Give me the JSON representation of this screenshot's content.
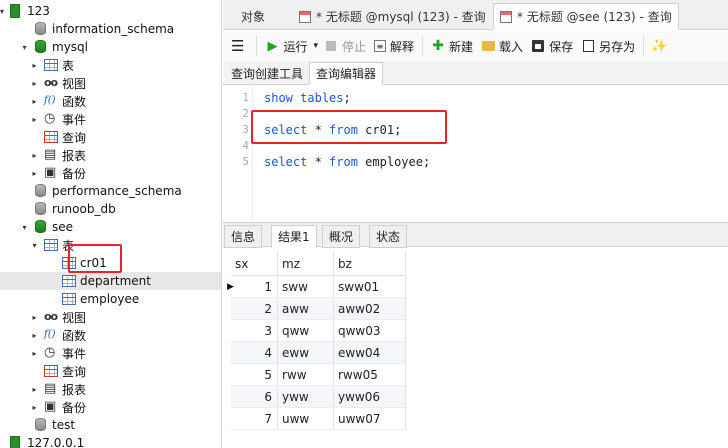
{
  "tree": {
    "items": [
      {
        "label": "123",
        "icon": "server-icon",
        "arrow": "▾",
        "indent": 0
      },
      {
        "label": "information_schema",
        "icon": "database-gray-icon",
        "arrow": "",
        "indent": 1
      },
      {
        "label": "mysql",
        "icon": "database-green-icon",
        "arrow": "▾",
        "indent": 1
      },
      {
        "label": "表",
        "icon": "table-icon",
        "arrow": "▸",
        "indent": 2
      },
      {
        "label": "视图",
        "icon": "view-icon",
        "arrow": "▸",
        "indent": 2
      },
      {
        "label": "函数",
        "icon": "function-icon",
        "arrow": "▸",
        "indent": 2
      },
      {
        "label": "事件",
        "icon": "event-icon",
        "arrow": "▸",
        "indent": 2
      },
      {
        "label": "查询",
        "icon": "query-icon",
        "arrow": "",
        "indent": 2
      },
      {
        "label": "报表",
        "icon": "report-icon",
        "arrow": "▸",
        "indent": 2
      },
      {
        "label": "备份",
        "icon": "backup-icon",
        "arrow": "▸",
        "indent": 2
      },
      {
        "label": "performance_schema",
        "icon": "database-gray-icon",
        "arrow": "",
        "indent": 1
      },
      {
        "label": "runoob_db",
        "icon": "database-gray-icon",
        "arrow": "",
        "indent": 1
      },
      {
        "label": "see",
        "icon": "database-green-icon",
        "arrow": "▾",
        "indent": 1
      },
      {
        "label": "表",
        "icon": "table-icon",
        "arrow": "▾",
        "indent": 2
      },
      {
        "label": "cr01",
        "icon": "table-icon",
        "arrow": "",
        "indent": 3
      },
      {
        "label": "department",
        "icon": "table-icon",
        "arrow": "",
        "indent": 3,
        "selected": true
      },
      {
        "label": "employee",
        "icon": "table-icon",
        "arrow": "",
        "indent": 3
      },
      {
        "label": "视图",
        "icon": "view-icon",
        "arrow": "▸",
        "indent": 2
      },
      {
        "label": "函数",
        "icon": "function-icon",
        "arrow": "▸",
        "indent": 2
      },
      {
        "label": "事件",
        "icon": "event-icon",
        "arrow": "▸",
        "indent": 2
      },
      {
        "label": "查询",
        "icon": "query-icon",
        "arrow": "",
        "indent": 2
      },
      {
        "label": "报表",
        "icon": "report-icon",
        "arrow": "▸",
        "indent": 2
      },
      {
        "label": "备份",
        "icon": "backup-icon",
        "arrow": "▸",
        "indent": 2
      },
      {
        "label": "test",
        "icon": "database-gray-icon",
        "arrow": "",
        "indent": 1
      },
      {
        "label": "127.0.0.1",
        "icon": "server-icon",
        "arrow": "",
        "indent": 0
      }
    ]
  },
  "tabs": [
    {
      "label": "对象",
      "active": false
    },
    {
      "label": "* 无标题 @mysql (123) - 查询",
      "active": false
    },
    {
      "label": "* 无标题 @see (123) - 查询",
      "active": true
    }
  ],
  "toolbar": {
    "menu_icon": "hamburger-icon",
    "run_label": "运行",
    "run_dropdown": "▾",
    "stop_label": "停止",
    "explain_label": "解释",
    "new_label": "新建",
    "load_label": "载入",
    "save_label": "保存",
    "saveas_label": "另存为"
  },
  "subtabs": [
    {
      "label": "查询创建工具",
      "active": false
    },
    {
      "label": "查询编辑器",
      "active": true
    }
  ],
  "editor": {
    "lines": [
      {
        "n": "1",
        "tokens": [
          {
            "t": "show",
            "k": "kw"
          },
          {
            "t": " ",
            "k": "tx"
          },
          {
            "t": "tables",
            "k": "kw"
          },
          {
            "t": ";",
            "k": "tx"
          }
        ]
      },
      {
        "n": "2",
        "tokens": []
      },
      {
        "n": "3",
        "tokens": [
          {
            "t": "select",
            "k": "kw"
          },
          {
            "t": " * ",
            "k": "tx"
          },
          {
            "t": "from",
            "k": "kw"
          },
          {
            "t": " cr01;",
            "k": "tx"
          }
        ]
      },
      {
        "n": "4",
        "tokens": []
      },
      {
        "n": "5",
        "tokens": [
          {
            "t": "select",
            "k": "kw"
          },
          {
            "t": " * ",
            "k": "tx"
          },
          {
            "t": "from",
            "k": "kw"
          },
          {
            "t": " employee;",
            "k": "tx"
          }
        ]
      }
    ]
  },
  "result_tabs": [
    {
      "label": "信息",
      "active": false
    },
    {
      "label": "结果1",
      "active": true
    },
    {
      "label": "概况",
      "active": false
    },
    {
      "label": "状态",
      "active": false
    }
  ],
  "grid": {
    "columns": [
      "sx",
      "mz",
      "bz"
    ],
    "current_row_marker": "▶",
    "rows": [
      [
        "1",
        "sww",
        "sww01"
      ],
      [
        "2",
        "aww",
        "aww02"
      ],
      [
        "3",
        "qww",
        "qww03"
      ],
      [
        "4",
        "eww",
        "eww04"
      ],
      [
        "5",
        "rww",
        "rww05"
      ],
      [
        "6",
        "yww",
        "yww06"
      ],
      [
        "7",
        "uww",
        "uww07"
      ]
    ]
  },
  "colors": {
    "keyword": "#1f55c5",
    "highlight": "#e8232a",
    "run_green": "#1fa31f"
  }
}
